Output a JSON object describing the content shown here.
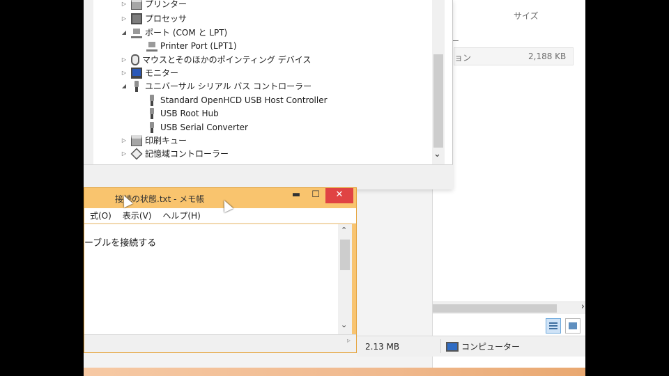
{
  "explorer": {
    "column_size": "サイズ",
    "folder_label": "ルダー",
    "row_name": "ョン",
    "row_size": "2,188 KB",
    "scroll_right": "›"
  },
  "device_manager": {
    "tree": [
      {
        "label": "プリンター",
        "arrow": "▷",
        "icon": "printer-icon",
        "level": 0
      },
      {
        "label": "プロセッサ",
        "arrow": "▷",
        "icon": "processor-icon",
        "level": 0
      },
      {
        "label": "ポート (COM と LPT)",
        "arrow": "◢",
        "icon": "port-icon",
        "level": 0
      },
      {
        "label": "Printer Port (LPT1)",
        "arrow": "",
        "icon": "port-icon",
        "level": 1
      },
      {
        "label": "マウスとそのほかのポインティング デバイス",
        "arrow": "▷",
        "icon": "mouse-icon",
        "level": 0
      },
      {
        "label": "モニター",
        "arrow": "▷",
        "icon": "monitor-icon",
        "level": 0
      },
      {
        "label": "ユニバーサル シリアル バス コントローラー",
        "arrow": "◢",
        "icon": "usb-icon",
        "level": 0
      },
      {
        "label": "Standard OpenHCD USB Host Controller",
        "arrow": "",
        "icon": "usb-icon",
        "level": 1
      },
      {
        "label": "USB Root Hub",
        "arrow": "",
        "icon": "usb-icon",
        "level": 1
      },
      {
        "label": "USB Serial Converter",
        "arrow": "",
        "icon": "usb-icon",
        "level": 1
      },
      {
        "label": "印刷キュー",
        "arrow": "▷",
        "icon": "print-queue-icon",
        "level": 0
      },
      {
        "label": "記憶域コントローラー",
        "arrow": "▷",
        "icon": "storage-controller-icon",
        "level": 0
      }
    ],
    "scroll_down": "⌄"
  },
  "notepad": {
    "title": "接続の状態.txt - メモ帳",
    "min": "▬",
    "max": "☐",
    "close": "✕",
    "menus": [
      "式(O)",
      "表示(V)",
      "ヘルプ(H)"
    ],
    "content": "ーブルを接続する",
    "scroll_up": "⌃",
    "scroll_down": "⌄",
    "grip": "▹"
  },
  "statusbar": {
    "size": "2.13 MB",
    "location": "コンピューター"
  }
}
